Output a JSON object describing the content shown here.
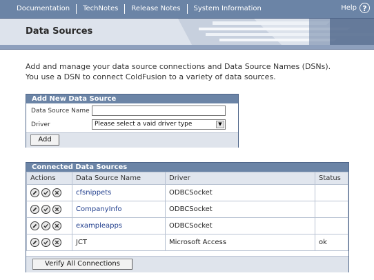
{
  "nav": {
    "links": [
      "Documentation",
      "TechNotes",
      "Release Notes",
      "System Information"
    ],
    "help_label": "Help",
    "help_icon": "?"
  },
  "header": {
    "title": "Data Sources"
  },
  "intro": {
    "line1": "Add and manage your data source connections and Data Source Names (DSNs).",
    "line2": "You use a DSN to connect ColdFusion to a variety of data sources."
  },
  "add_panel": {
    "title": "Add New Data Source",
    "name_label": "Data Source Name",
    "name_value": "",
    "driver_label": "Driver",
    "driver_selected": "Please select a vaid driver type",
    "add_button": "Add"
  },
  "connected": {
    "title": "Connected Data Sources",
    "columns": [
      "Actions",
      "Data Source Name",
      "Driver",
      "Status"
    ],
    "rows": [
      {
        "name": "cfsnippets",
        "driver": "ODBCSocket",
        "status": ""
      },
      {
        "name": "CompanyInfo",
        "driver": "ODBCSocket",
        "status": ""
      },
      {
        "name": "exampleapps",
        "driver": "ODBCSocket",
        "status": ""
      },
      {
        "name": "JCT",
        "driver": "Microsoft Access",
        "status": "ok"
      }
    ],
    "verify_button": "Verify All Connections"
  },
  "colors": {
    "nav_bg": "#6b84a6",
    "panel_head": "#6b84a6",
    "header_band": "#dde3ec"
  }
}
